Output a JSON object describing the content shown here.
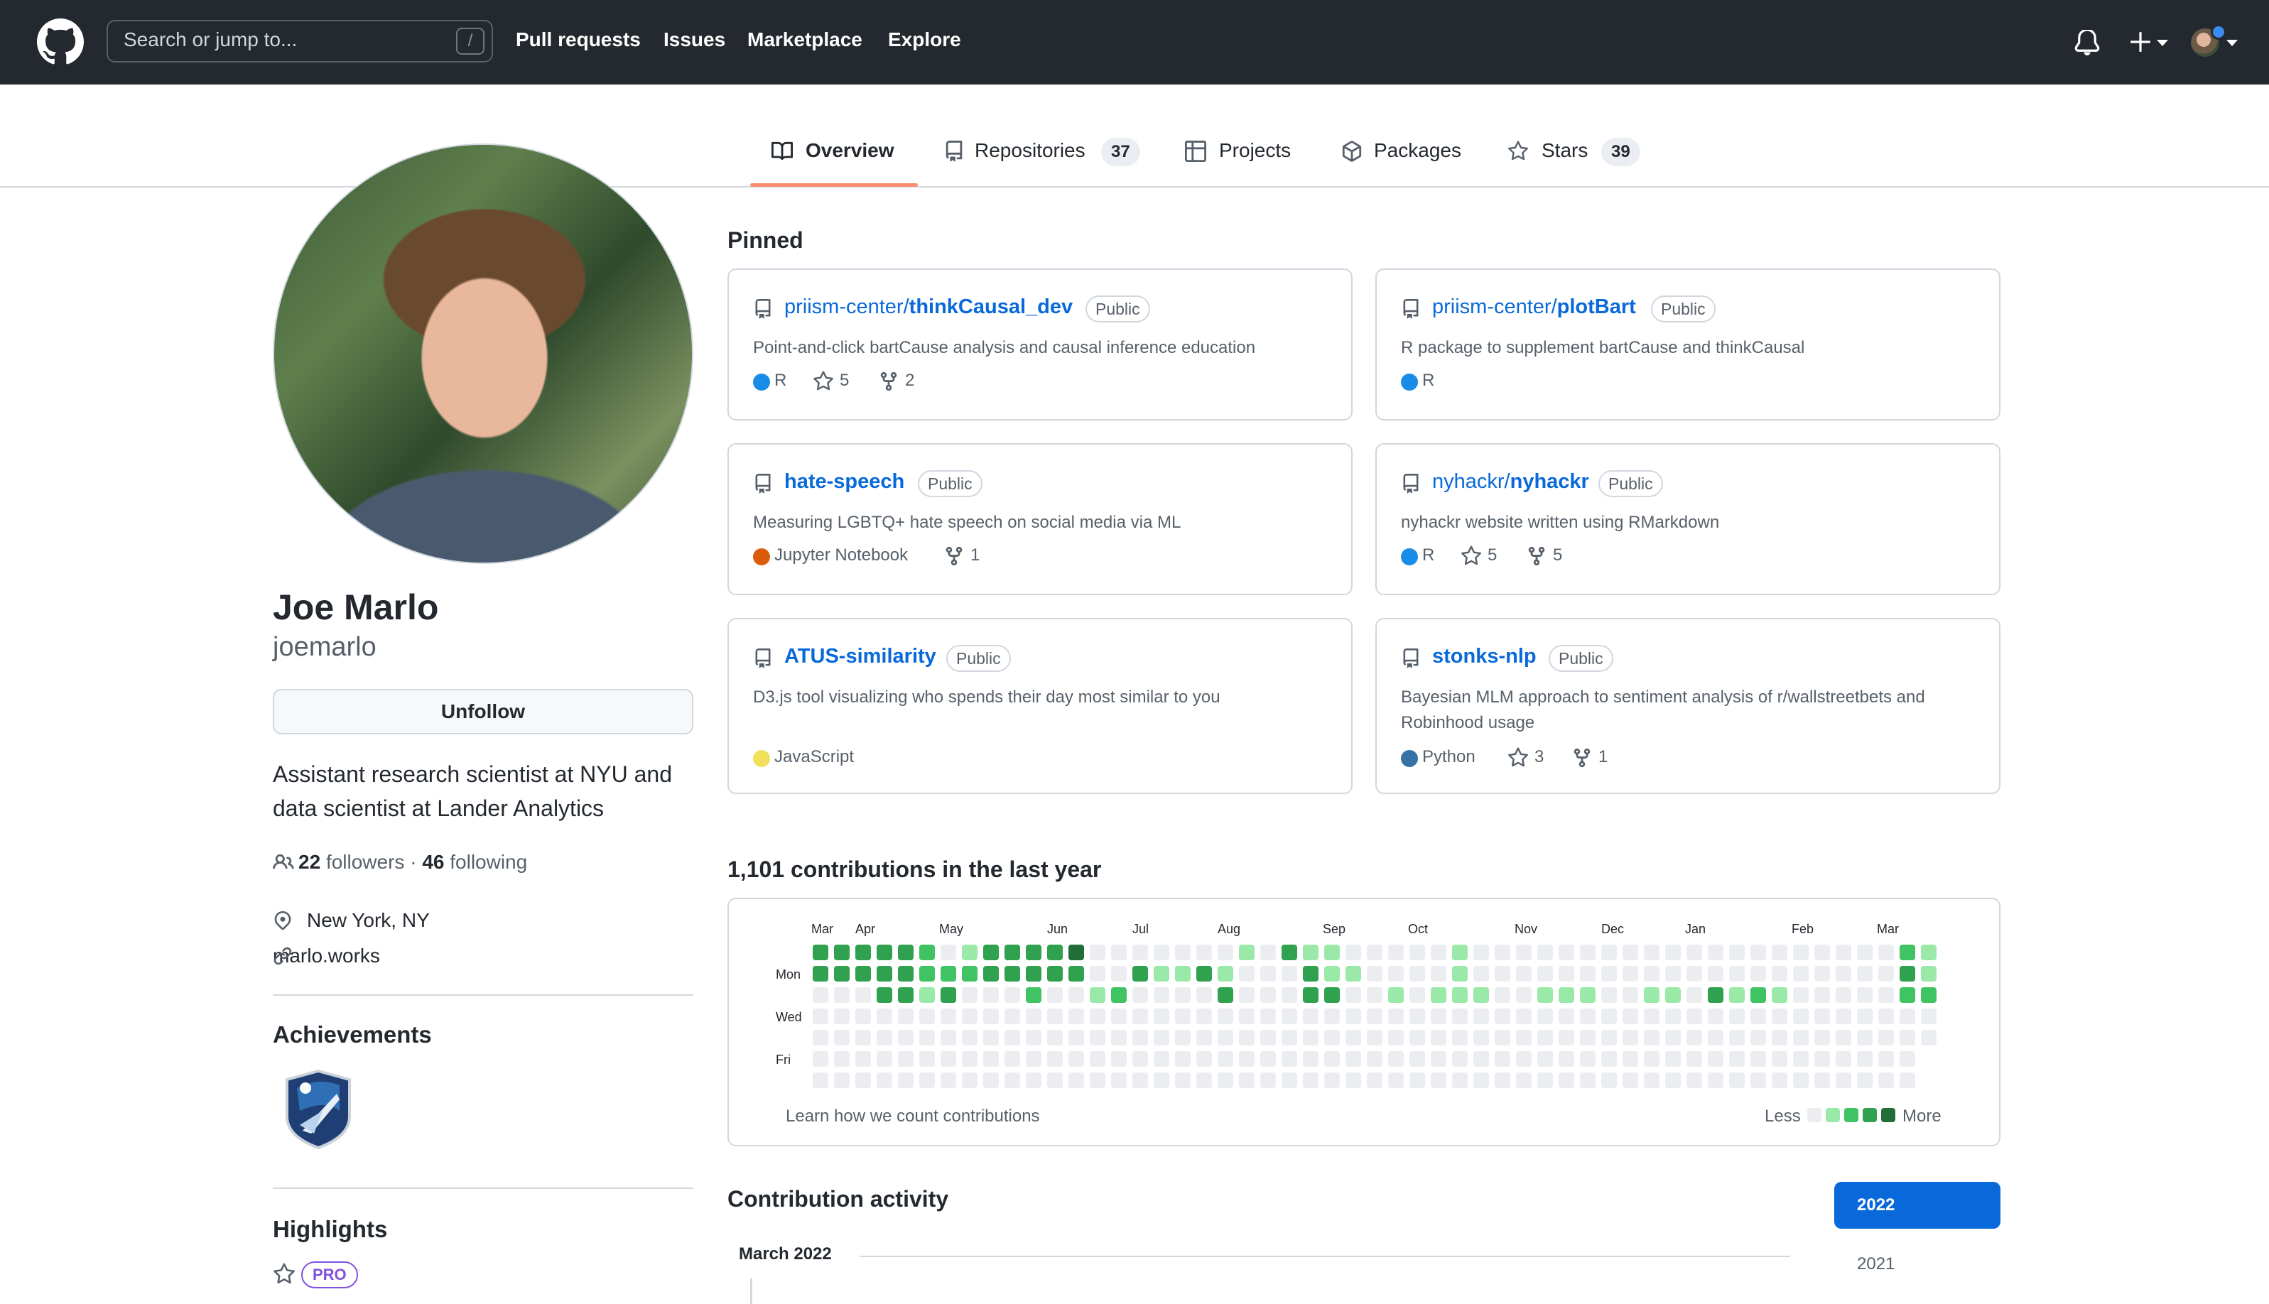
{
  "header": {
    "search_placeholder": "Search or jump to...",
    "search_shortcut": "/",
    "nav": [
      "Pull requests",
      "Issues",
      "Marketplace",
      "Explore"
    ]
  },
  "tabs": [
    {
      "label": "Overview",
      "icon": "book-icon",
      "active": true
    },
    {
      "label": "Repositories",
      "icon": "repo-icon",
      "count": "37"
    },
    {
      "label": "Projects",
      "icon": "table-icon"
    },
    {
      "label": "Packages",
      "icon": "package-icon"
    },
    {
      "label": "Stars",
      "icon": "star-icon",
      "count": "39"
    }
  ],
  "profile": {
    "name": "Joe Marlo",
    "login": "joemarlo",
    "follow_button": "Unfollow",
    "bio": "Assistant research scientist at NYU and data scientist at Lander Analytics",
    "followers_count": "22",
    "followers_label": "followers",
    "separator": "·",
    "following_count": "46",
    "following_label": "following",
    "location": "New York, NY",
    "website": "marlo.works",
    "achievements_title": "Achievements",
    "highlights_title": "Highlights",
    "pro_label": "PRO"
  },
  "pinned": {
    "title": "Pinned",
    "repos": [
      {
        "owner": "priism-center/",
        "name": "thinkCausal_dev",
        "visibility": "Public",
        "description": "Point-and-click bartCause analysis and causal inference education",
        "language": "R",
        "language_color": "#198CE7",
        "stars": "5",
        "forks": "2"
      },
      {
        "owner": "priism-center/",
        "name": "plotBart",
        "visibility": "Public",
        "description": "R package to supplement bartCause and thinkCausal",
        "language": "R",
        "language_color": "#198CE7",
        "stars": "",
        "forks": ""
      },
      {
        "owner": "",
        "name": "hate-speech",
        "visibility": "Public",
        "description": "Measuring LGBTQ+ hate speech on social media via ML",
        "language": "Jupyter Notebook",
        "language_color": "#DA5B0B",
        "stars": "",
        "forks": "1"
      },
      {
        "owner": "nyhackr/",
        "name": "nyhackr",
        "visibility": "Public",
        "description": "nyhackr website written using RMarkdown",
        "language": "R",
        "language_color": "#198CE7",
        "stars": "5",
        "forks": "5"
      },
      {
        "owner": "",
        "name": "ATUS-similarity",
        "visibility": "Public",
        "description": "D3.js tool visualizing who spends their day most similar to you",
        "language": "JavaScript",
        "language_color": "#f1e05a",
        "stars": "",
        "forks": ""
      },
      {
        "owner": "",
        "name": "stonks-nlp",
        "visibility": "Public",
        "description": "Bayesian MLM approach to sentiment analysis of r/wallstreetbets and Robinhood usage",
        "language": "Python",
        "language_color": "#3572A5",
        "stars": "3",
        "forks": "1"
      }
    ]
  },
  "contributions": {
    "title": "1,101 contributions in the last year",
    "months": [
      "Mar",
      "Apr",
      "May",
      "Jun",
      "Jul",
      "Aug",
      "Sep",
      "Oct",
      "Nov",
      "Dec",
      "Jan",
      "Feb",
      "Mar"
    ],
    "weekdays": [
      "Mon",
      "Wed",
      "Fri"
    ],
    "learn_link": "Learn how we count contributions",
    "legend_less": "Less",
    "legend_more": "More",
    "level_colors": [
      "#ebedf0",
      "#9be9a8",
      "#40c463",
      "#30a14e",
      "#216e39"
    ],
    "levels": [
      "3333320133334000000010311000001000000000000000000002111003300000000000001021000103030030111002433330000111113430002330000000000003100001330002023132000001102200000100000000",
      "3333322233333003113100031100001000000000000000000003133003300003000000004000000003330000030001222300022311011203300222000000001032200000101210002110000001120112011121000100",
      "0003313000200120000300033001011100111001103121000002201020011000011000121100033300001221002300000313223000301001022003030010101100010000233000022200030100320000000220000000",
      "0000000000000000000000000000000000000000000000000000000000000000000000000000000000000000000000000000000000000000000000000000000000000000000000000000000000000000000000000000",
      "0000000000000000000000000000000000000000000000000000000000000000000000000000000000000000000000000000000000000000000000000000000000000000000000000000000000000000000000000000",
      "0000000000000000000000000000000000000000000000000000000000000000000000000000000000000000000000000000000000000000000000000000000000000000000000000000000000000000000000000000",
      "0000000000000000000000000000000000000000000000000000000000000000000000000000000000000000000000000000000000000000000000000000000000000000000000000000000000000000000000000000"
    ]
  },
  "activity": {
    "title": "Contribution activity",
    "month_heading": "March 2022",
    "years": [
      "2022",
      "2021"
    ]
  }
}
